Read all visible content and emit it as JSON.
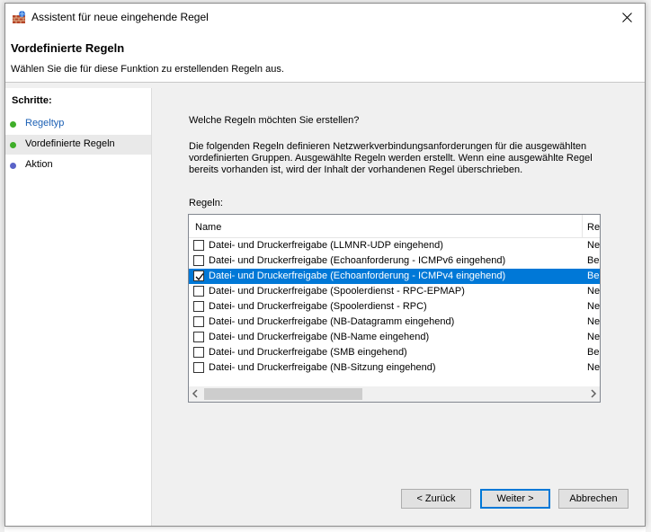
{
  "window": {
    "title": "Assistent für neue eingehende Regel"
  },
  "header": {
    "title": "Vordefinierte Regeln",
    "subtitle": "Wählen Sie die für diese Funktion zu erstellenden Regeln aus."
  },
  "sidebar": {
    "label": "Schritte:",
    "steps": [
      {
        "label": "Regeltyp",
        "color": "#3fae29",
        "link": true
      },
      {
        "label": "Vordefinierte Regeln",
        "color": "#3fae29",
        "active": true
      },
      {
        "label": "Aktion",
        "color": "#5a63c8"
      }
    ]
  },
  "main": {
    "question": "Welche Regeln möchten Sie erstellen?",
    "description": "Die folgenden Regeln definieren Netzwerkverbindungsanforderungen für die ausgewählten vordefinierten Gruppen. Ausgewählte Regeln werden erstellt. Wenn eine ausgewählte Regel bereits vorhanden ist, wird der Inhalt der vorhandenen Regel überschrieben.",
    "rules_label": "Regeln:",
    "columns": [
      "Name",
      "Re"
    ],
    "rules": [
      {
        "name": "Datei- und Druckerfreigabe (LLMNR-UDP eingehend)",
        "col2": "Ne",
        "checked": false
      },
      {
        "name": "Datei- und Druckerfreigabe (Echoanforderung - ICMPv6 eingehend)",
        "col2": "Be",
        "checked": false
      },
      {
        "name": "Datei- und Druckerfreigabe (Echoanforderung - ICMPv4 eingehend)",
        "col2": "Be",
        "checked": true,
        "selected": true
      },
      {
        "name": "Datei- und Druckerfreigabe (Spoolerdienst - RPC-EPMAP)",
        "col2": "Ne",
        "checked": false
      },
      {
        "name": "Datei- und Druckerfreigabe (Spoolerdienst - RPC)",
        "col2": "Ne",
        "checked": false
      },
      {
        "name": "Datei- und Druckerfreigabe (NB-Datagramm eingehend)",
        "col2": "Ne",
        "checked": false
      },
      {
        "name": "Datei- und Druckerfreigabe (NB-Name eingehend)",
        "col2": "Ne",
        "checked": false
      },
      {
        "name": "Datei- und Druckerfreigabe (SMB eingehend)",
        "col2": "Be",
        "checked": false
      },
      {
        "name": "Datei- und Druckerfreigabe (NB-Sitzung eingehend)",
        "col2": "Ne",
        "checked": false
      }
    ]
  },
  "buttons": {
    "back": "< Zurück",
    "next": "Weiter >",
    "cancel": "Abbrechen"
  },
  "colors": {
    "selection": "#0078d7",
    "link": "#1a5fb4"
  }
}
